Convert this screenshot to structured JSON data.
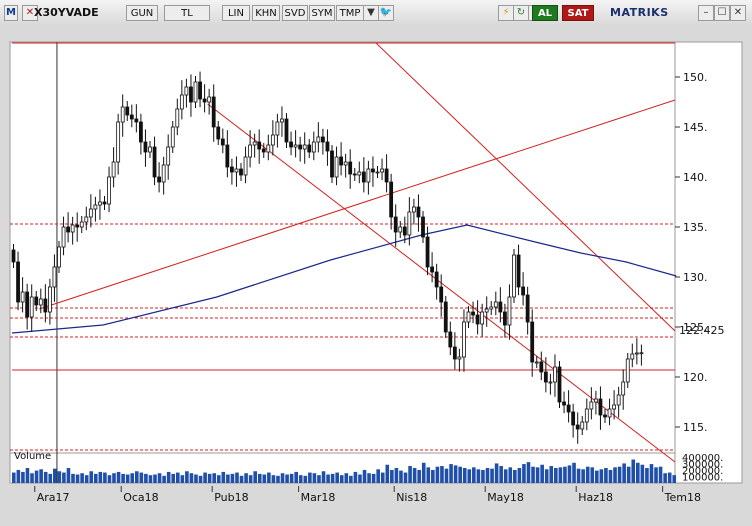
{
  "toolbar": {
    "m_label": "M",
    "symbol": "X30YVADE",
    "buttons": [
      "GUN",
      "TL",
      "LIN",
      "KHN",
      "SVD",
      "SYM",
      "TMP"
    ],
    "al_label": "AL",
    "sat_label": "SAT",
    "brand": "MATRIKS",
    "colors": {
      "al": "#1e7a1e",
      "sat": "#b01818",
      "brand_dot": "#cc1a1a"
    },
    "icons": [
      "close-icon",
      "dropdown-icon",
      "twitter-icon",
      "lightning-icon",
      "refresh-icon",
      "c-icon",
      "minimize-icon",
      "maximize-icon",
      "close-window-icon"
    ]
  },
  "chart_data": {
    "type": "candlestick",
    "price_axis": {
      "ticks": [
        150,
        145,
        140,
        135,
        130,
        125,
        120,
        115
      ],
      "labels": [
        "150.",
        "145.",
        "140.",
        "135.",
        "130.",
        "125.",
        "120.",
        "115."
      ],
      "range": [
        112.4,
        153.5
      ]
    },
    "current_price_label": "122.425",
    "current_price": 122.425,
    "x_labels": [
      "Ara17",
      "Oca18",
      "Pub18",
      "Mar18",
      "Nis18",
      "May18",
      "Haz18",
      "Tem18"
    ],
    "x_label_index": [
      5,
      24,
      44,
      63,
      84,
      104,
      124,
      143
    ],
    "count": 146,
    "closes": [
      131.5,
      127.5,
      128.5,
      126,
      128,
      127.2,
      127.8,
      126.5,
      129,
      131,
      133,
      135,
      134.5,
      135.2,
      135,
      135.5,
      136,
      136.8,
      137.2,
      137.5,
      137.3,
      140,
      141.5,
      145.5,
      147,
      146.2,
      145.8,
      145.5,
      143.5,
      142.5,
      143,
      140,
      139.5,
      141.2,
      143,
      145,
      146.8,
      148.2,
      149,
      147.5,
      149.5,
      147.8,
      147.5,
      148,
      145,
      143.8,
      143.2,
      141,
      140.5,
      140.8,
      140.2,
      142,
      143.2,
      143.5,
      142.8,
      142.5,
      143.2,
      144.2,
      145.5,
      145.8,
      143.5,
      143,
      143.2,
      142.8,
      143.2,
      142.5,
      143.5,
      144,
      143.5,
      142.6,
      140,
      142,
      141.2,
      141.5,
      140.3,
      140.2,
      140.5,
      139.5,
      140.8,
      140.5,
      140.5,
      140.8,
      139.5,
      136,
      134.5,
      135,
      134.2,
      136.5,
      137,
      136,
      134,
      131,
      130.5,
      129,
      127.5,
      124.5,
      123,
      121.8,
      122,
      125.5,
      126.5,
      126.2,
      125.3,
      126.5,
      126.8,
      127,
      127.5,
      126.5,
      125.2,
      128,
      132.2,
      129,
      128.2,
      125.5,
      121.5,
      121.5,
      120.5,
      119.5,
      119.5,
      121,
      117.5,
      117.2,
      116.5,
      115.2,
      114.8,
      115.5,
      116.8,
      117.5,
      117.8,
      116.2,
      116,
      116.8,
      117.2,
      118.2,
      119.5,
      121.8,
      122.3,
      122.4,
      122.425
    ],
    "ma": [
      [
        0,
        124.4
      ],
      [
        20,
        125.2
      ],
      [
        45,
        128
      ],
      [
        70,
        131.7
      ],
      [
        90,
        134.2
      ],
      [
        100,
        135.2
      ],
      [
        115,
        133.5
      ],
      [
        125,
        132.4
      ],
      [
        135,
        131.5
      ],
      [
        146,
        130.1
      ]
    ],
    "lines_solid": [
      [
        0,
        153.4,
        150.2,
        153.4
      ],
      [
        0,
        120.7,
        150.2,
        120.7
      ],
      [
        6,
        126.8,
        150.2,
        147.7
      ]
    ],
    "lines_dashed": [
      124,
      135.3,
      126.9,
      125.9,
      112.7
    ],
    "channel": [
      [
        80,
        153.4,
        150.2,
        124.6
      ],
      [
        43,
        147.3,
        150.2,
        111.5
      ]
    ],
    "crosshair_index": 9,
    "volume": {
      "label": "Volume",
      "axis_labels": [
        "400000.",
        "300000.",
        "200000.",
        "100000."
      ],
      "axis_values": [
        400000,
        300000,
        200000,
        100000
      ],
      "max": 460000,
      "values": [
        160000,
        200000,
        170000,
        230000,
        150000,
        190000,
        210000,
        170000,
        140000,
        220000,
        180000,
        160000,
        230000,
        140000,
        130000,
        150000,
        120000,
        180000,
        140000,
        170000,
        160000,
        120000,
        150000,
        170000,
        140000,
        130000,
        150000,
        180000,
        160000,
        140000,
        120000,
        130000,
        150000,
        110000,
        170000,
        140000,
        160000,
        120000,
        180000,
        150000,
        130000,
        110000,
        160000,
        140000,
        150000,
        120000,
        170000,
        130000,
        140000,
        160000,
        110000,
        150000,
        120000,
        180000,
        140000,
        130000,
        160000,
        120000,
        110000,
        150000,
        130000,
        140000,
        170000,
        120000,
        110000,
        160000,
        150000,
        120000,
        180000,
        130000,
        140000,
        160000,
        120000,
        150000,
        110000,
        170000,
        130000,
        200000,
        150000,
        140000,
        210000,
        160000,
        280000,
        200000,
        230000,
        190000,
        160000,
        260000,
        230000,
        200000,
        310000,
        240000,
        200000,
        250000,
        260000,
        220000,
        290000,
        270000,
        250000,
        230000,
        210000,
        240000,
        210000,
        200000,
        230000,
        220000,
        300000,
        260000,
        210000,
        240000,
        200000,
        230000,
        290000,
        320000,
        250000,
        240000,
        280000,
        210000,
        260000,
        230000,
        240000,
        250000,
        270000,
        310000,
        220000,
        210000,
        250000,
        240000,
        190000,
        210000,
        230000,
        200000,
        240000,
        250000,
        300000,
        250000,
        360000,
        310000,
        280000,
        230000,
        290000,
        240000,
        250000,
        150000,
        160000,
        120000
      ]
    }
  }
}
